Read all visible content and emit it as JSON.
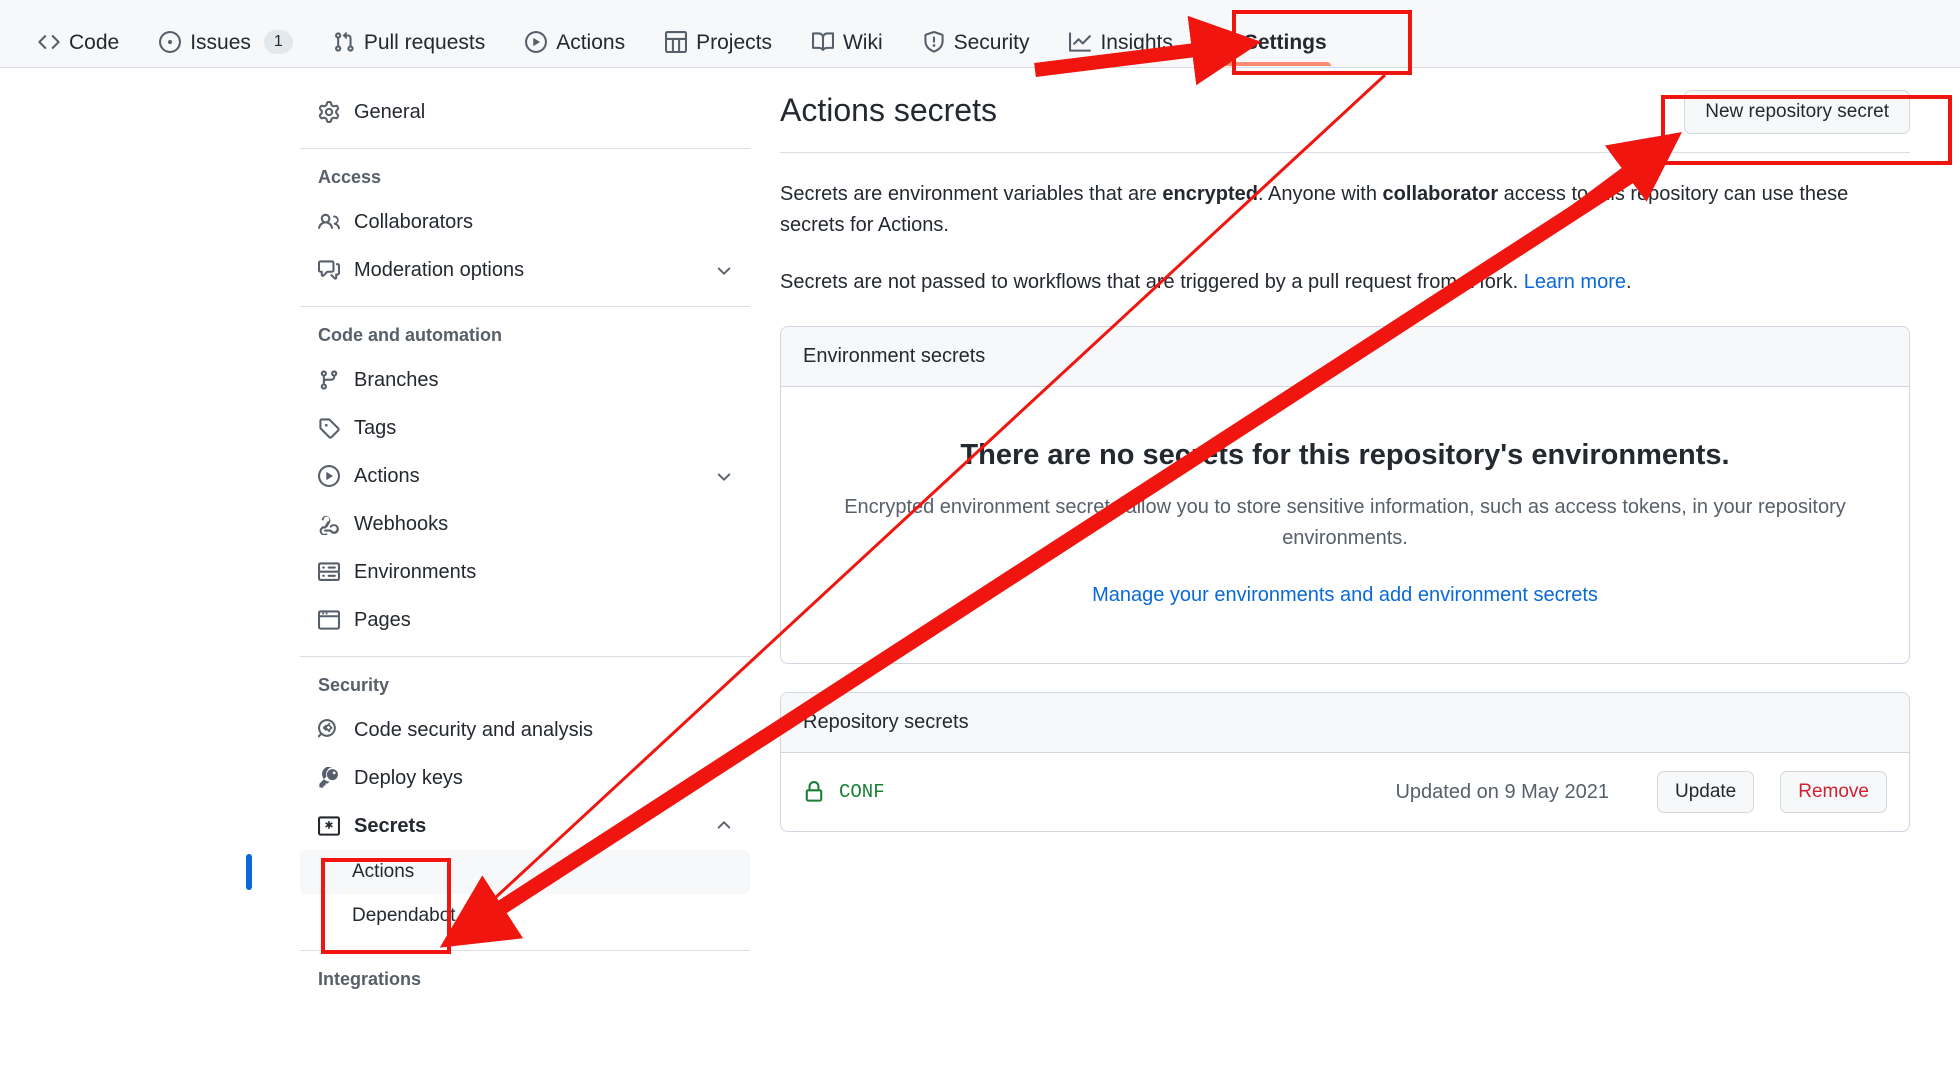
{
  "repo_nav": {
    "items": [
      {
        "label": "Code",
        "icon": "code-icon",
        "active": false,
        "count": null
      },
      {
        "label": "Issues",
        "icon": "issue-opened-icon",
        "active": false,
        "count": "1"
      },
      {
        "label": "Pull requests",
        "icon": "git-pull-request-icon",
        "active": false,
        "count": null
      },
      {
        "label": "Actions",
        "icon": "play-icon",
        "active": false,
        "count": null
      },
      {
        "label": "Projects",
        "icon": "table-icon",
        "active": false,
        "count": null
      },
      {
        "label": "Wiki",
        "icon": "book-icon",
        "active": false,
        "count": null
      },
      {
        "label": "Security",
        "icon": "shield-icon",
        "active": false,
        "count": null
      },
      {
        "label": "Insights",
        "icon": "graph-icon",
        "active": false,
        "count": null
      },
      {
        "label": "Settings",
        "icon": "gear-icon",
        "active": true,
        "count": null
      }
    ]
  },
  "sidebar": {
    "general": {
      "label": "General",
      "icon": "gear-icon"
    },
    "groups": [
      {
        "title": "Access",
        "items": [
          {
            "label": "Collaborators",
            "icon": "people-icon",
            "chevron": null
          },
          {
            "label": "Moderation options",
            "icon": "comment-discussion-icon",
            "chevron": "chevron-down-icon"
          }
        ]
      },
      {
        "title": "Code and automation",
        "items": [
          {
            "label": "Branches",
            "icon": "git-branch-icon",
            "chevron": null
          },
          {
            "label": "Tags",
            "icon": "tag-icon",
            "chevron": null
          },
          {
            "label": "Actions",
            "icon": "play-icon",
            "chevron": "chevron-down-icon"
          },
          {
            "label": "Webhooks",
            "icon": "webhook-icon",
            "chevron": null
          },
          {
            "label": "Environments",
            "icon": "server-icon",
            "chevron": null
          },
          {
            "label": "Pages",
            "icon": "browser-icon",
            "chevron": null
          }
        ]
      },
      {
        "title": "Security",
        "items": [
          {
            "label": "Code security and analysis",
            "icon": "codescan-icon",
            "chevron": null
          },
          {
            "label": "Deploy keys",
            "icon": "key-icon",
            "chevron": null
          },
          {
            "label": "Secrets",
            "icon": "asterisk-key-icon",
            "chevron": "chevron-up-icon",
            "highlighted": true
          }
        ]
      }
    ],
    "secrets_subitems": [
      {
        "label": "Actions",
        "selected": true
      },
      {
        "label": "Dependabot",
        "selected": false
      }
    ],
    "last_group_title": "Integrations"
  },
  "main": {
    "title": "Actions secrets",
    "new_secret_button": "New repository secret",
    "paragraph1": {
      "part1": "Secrets are environment variables that are ",
      "bold1": "encrypted",
      "part2": ". Anyone with ",
      "bold2": "collaborator",
      "part3": " access to this repository can use these secrets for Actions."
    },
    "paragraph2": {
      "text": "Secrets are not passed to workflows that are triggered by a pull request from a fork. ",
      "link": "Learn more",
      "tail": "."
    },
    "environment_secrets": {
      "header": "Environment secrets",
      "blank_title": "There are no secrets for this repository's environments.",
      "blank_desc": "Encrypted environment secrets allow you to store sensitive information, such as access tokens, in your repository environments.",
      "blank_link": "Manage your environments and add environment secrets"
    },
    "repository_secrets": {
      "header": "Repository secrets",
      "rows": [
        {
          "name": "CONF",
          "updated": "Updated on 9 May 2021",
          "update_label": "Update",
          "remove_label": "Remove"
        }
      ]
    }
  },
  "annotations": {
    "accent_color": "#f0150f",
    "boxes": [
      "settings-tab",
      "new-repository-secret-button",
      "secrets-actions-sidebar"
    ],
    "arrows": [
      "thick-arrow-to-sidebar-actions",
      "thin-arrow-to-sidebar-actions",
      "arrow-to-settings-tab",
      "arrow-to-new-secret-button"
    ]
  }
}
